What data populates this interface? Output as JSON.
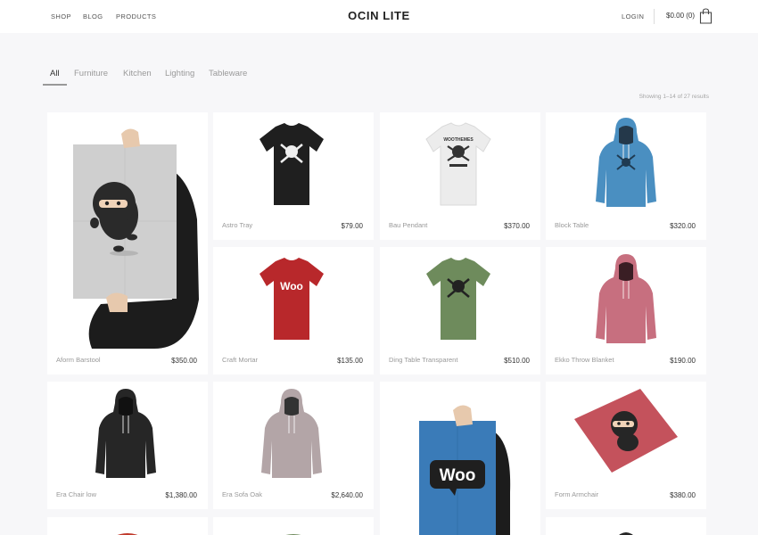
{
  "header": {
    "nav": [
      "SHOP",
      "BLOG",
      "PRODUCTS"
    ],
    "brand": "OCIN LITE",
    "login": "LOGIN",
    "cart_total": "$0.00 (0)",
    "cart_icon": "shopping-bag-icon"
  },
  "filters": {
    "tabs": [
      "All",
      "Furniture",
      "Kitchen",
      "Lighting",
      "Tableware"
    ],
    "active": "All"
  },
  "results": "Showing 1–14 of 27 results",
  "products": [
    {
      "name": "Aform Barstool",
      "price": "$350.00",
      "image": "ninja-poster"
    },
    {
      "name": "Astro Tray",
      "price": "$79.00",
      "image": "black-tshirt"
    },
    {
      "name": "Bau Pendant",
      "price": "$370.00",
      "image": "white-tshirt"
    },
    {
      "name": "Block Table",
      "price": "$320.00",
      "image": "blue-hoodie"
    },
    {
      "name": "Craft Mortar",
      "price": "$135.00",
      "image": "red-tshirt-woo"
    },
    {
      "name": "Ding Table Transparent",
      "price": "$510.00",
      "image": "green-tshirt"
    },
    {
      "name": "Ekko Throw Blanket",
      "price": "$190.00",
      "image": "pink-hoodie"
    },
    {
      "name": "Era Chair low",
      "price": "$1,380.00",
      "image": "black-hoodie"
    },
    {
      "name": "Era Sofa Oak",
      "price": "$2,640.00",
      "image": "grey-hoodie"
    },
    {
      "name": "",
      "price": "",
      "image": "woo-poster"
    },
    {
      "name": "Form Armchair",
      "price": "$380.00",
      "image": "ninja-card"
    }
  ],
  "logo_text": {
    "woo": "Woo",
    "woothemes": "WOOTHEMES"
  },
  "colors": {
    "accent_red": "#c0392b",
    "hoodie_blue": "#4a8fc1",
    "tshirt_green": "#6e8b5c",
    "hoodie_pink": "#c76f7f",
    "poster_blue": "#3a7bb8"
  }
}
